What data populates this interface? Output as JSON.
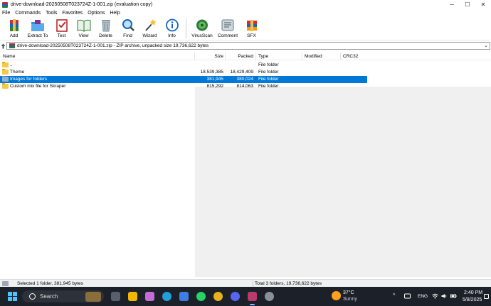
{
  "window": {
    "title": "drive-download-20250508T023724Z-1-001.zip (evaluation copy)",
    "minimize": "─",
    "maximize": "☐",
    "close": "✕"
  },
  "menu": [
    "File",
    "Commands",
    "Tools",
    "Favorites",
    "Options",
    "Help"
  ],
  "toolbar": [
    {
      "label": "Add",
      "icon": "add-archive-icon"
    },
    {
      "label": "Extract To",
      "icon": "extract-to-icon"
    },
    {
      "label": "Test",
      "icon": "test-icon"
    },
    {
      "label": "View",
      "icon": "view-icon"
    },
    {
      "label": "Delete",
      "icon": "delete-icon"
    },
    {
      "label": "Find",
      "icon": "find-icon"
    },
    {
      "label": "Wizard",
      "icon": "wizard-icon"
    },
    {
      "label": "Info",
      "icon": "info-icon"
    },
    {
      "label": "VirusScan",
      "icon": "virus-scan-icon"
    },
    {
      "label": "Comment",
      "icon": "comment-icon"
    },
    {
      "label": "SFX",
      "icon": "sfx-icon"
    }
  ],
  "path": {
    "text": "drive-download-20250508T023724Z-1-001.zip - ZIP archive, unpacked size 19,736,622 bytes",
    "dropdown": "⌄"
  },
  "columns": {
    "name": "Name",
    "size": "Size",
    "packed": "Packed",
    "type": "Type",
    "modified": "Modified",
    "crc": "CRC32"
  },
  "rows": [
    {
      "name": "..",
      "size": "",
      "packed": "",
      "type": "File folder",
      "selected": false
    },
    {
      "name": "Theme",
      "size": "18,539,385",
      "packed": "18,429,409",
      "type": "File folder",
      "selected": false
    },
    {
      "name": "Images for folders",
      "size": "381,945",
      "packed": "380,024",
      "type": "File folder",
      "selected": true
    },
    {
      "name": "Custom mix file for Skraper",
      "size": "815,292",
      "packed": "814,063",
      "type": "File folder",
      "selected": false
    }
  ],
  "status": {
    "left": "Selected 1 folder, 381,945 bytes",
    "right": "Total 3 folders, 19,736,622 bytes"
  },
  "taskbar": {
    "search_placeholder": "Search",
    "weather_temp": "37°C",
    "weather_condition": "Sunny",
    "tray_arrow": "^",
    "language": "ENG",
    "time": "2:40 PM",
    "date": "5/8/2025",
    "apps": [
      {
        "name": "task-view-icon",
        "color": "#5a5f6b"
      },
      {
        "name": "file-explorer-icon",
        "color": "#f2b705"
      },
      {
        "name": "copilot-icon",
        "color": "#c46bd6"
      },
      {
        "name": "edge-icon",
        "color": "#1fa0d8"
      },
      {
        "name": "store-icon",
        "color": "#3d7fe0"
      },
      {
        "name": "whatsapp-icon",
        "color": "#25d366"
      },
      {
        "name": "chrome-icon",
        "color": "#e8b21c"
      },
      {
        "name": "discord-icon",
        "color": "#5865f2"
      },
      {
        "name": "winrar-icon",
        "color": "#b83a6e"
      },
      {
        "name": "settings-icon",
        "color": "#8a8f99"
      }
    ]
  }
}
